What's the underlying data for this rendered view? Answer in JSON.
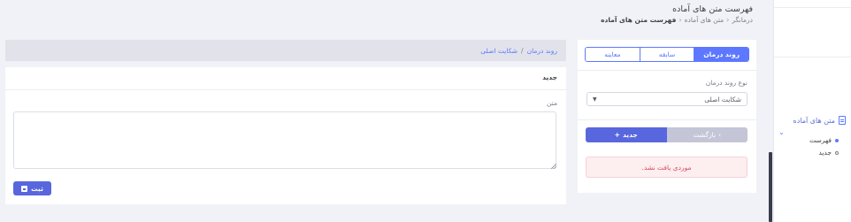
{
  "header": {
    "title": "فهرست متن های آماده",
    "breadcrumb": [
      "درمانگر",
      "متن های آماده",
      "فهرست متن های آماده"
    ],
    "separator": "‹"
  },
  "sidebar": {
    "section_label": "متن های آماده",
    "items": [
      {
        "label": "فهرست",
        "active": true
      },
      {
        "label": "جدید",
        "active": false
      }
    ]
  },
  "controls": {
    "tabs": [
      {
        "label": "روند درمان",
        "active": true
      },
      {
        "label": "سابقه",
        "active": false
      },
      {
        "label": "معاینه",
        "active": false
      }
    ],
    "select_label": "نوع روند درمان",
    "select_value": "شکایت اصلی",
    "new_button": "جدید",
    "new_icon": "+",
    "back_button": "بازگشت",
    "back_icon": "‹",
    "alert": "موردی یافت نشد."
  },
  "editor": {
    "crumb": [
      "روند درمان",
      "شکایت اصلی"
    ],
    "crumb_separator": "/",
    "title": "جدید",
    "field_label": "متن",
    "textarea_value": "",
    "save_button": "ثبت"
  },
  "colors": {
    "accent": "#5d78ff",
    "primary_button": "#5867dd",
    "alert_text": "#d54a62",
    "page_background": "#f1f2f7"
  }
}
